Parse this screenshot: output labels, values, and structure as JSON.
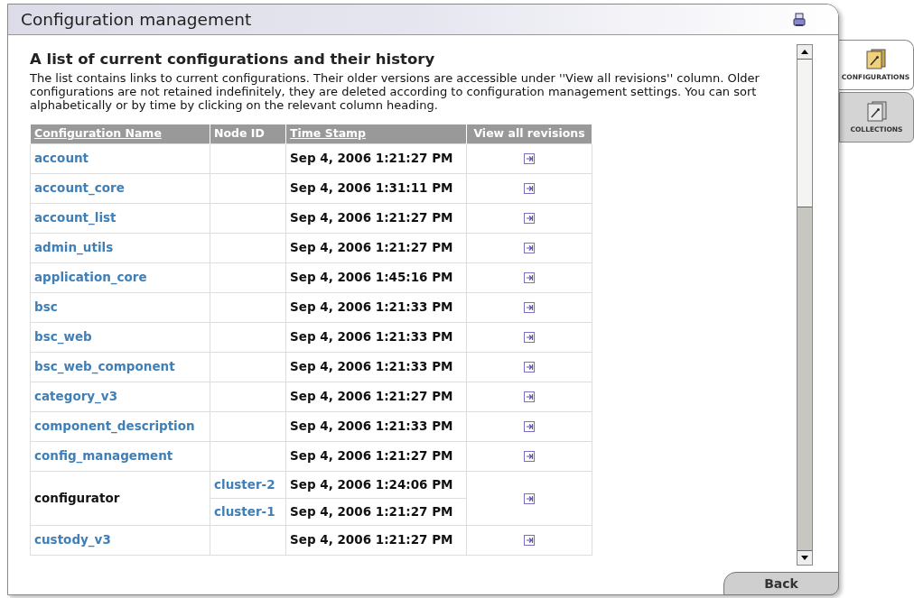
{
  "window": {
    "title": "Configuration management"
  },
  "heading": "A list of current configurations and their history",
  "description": "The list contains links to current configurations. Their older versions are accessible under ''View all revisions'' column. Older configurations are not retained indefinitely, they are deleted according to configuration management settings. You can sort alphabetically or by time by clicking on the relevant column heading.",
  "table": {
    "columns": [
      {
        "label": "Configuration Name",
        "sortable": true
      },
      {
        "label": "Node ID",
        "sortable": false
      },
      {
        "label": "Time Stamp",
        "sortable": true
      },
      {
        "label": "View all revisions",
        "sortable": false
      }
    ],
    "rows": [
      {
        "name": "account",
        "kind": "link",
        "entries": [
          {
            "time": "Sep 4, 2006 1:21:27 PM"
          }
        ]
      },
      {
        "name": "account_core",
        "kind": "link",
        "entries": [
          {
            "time": "Sep 4, 2006 1:31:11 PM"
          }
        ]
      },
      {
        "name": "account_list",
        "kind": "link",
        "entries": [
          {
            "time": "Sep 4, 2006 1:21:27 PM"
          }
        ]
      },
      {
        "name": "admin_utils",
        "kind": "link",
        "entries": [
          {
            "time": "Sep 4, 2006 1:21:27 PM"
          }
        ]
      },
      {
        "name": "application_core",
        "kind": "link",
        "entries": [
          {
            "time": "Sep 4, 2006 1:45:16 PM"
          }
        ]
      },
      {
        "name": "bsc",
        "kind": "link",
        "entries": [
          {
            "time": "Sep 4, 2006 1:21:33 PM"
          }
        ]
      },
      {
        "name": "bsc_web",
        "kind": "link",
        "entries": [
          {
            "time": "Sep 4, 2006 1:21:33 PM"
          }
        ]
      },
      {
        "name": "bsc_web_component",
        "kind": "link",
        "entries": [
          {
            "time": "Sep 4, 2006 1:21:33 PM"
          }
        ]
      },
      {
        "name": "category_v3",
        "kind": "link",
        "entries": [
          {
            "time": "Sep 4, 2006 1:21:27 PM"
          }
        ]
      },
      {
        "name": "component_description",
        "kind": "link",
        "entries": [
          {
            "time": "Sep 4, 2006 1:21:33 PM"
          }
        ]
      },
      {
        "name": "config_management",
        "kind": "link",
        "entries": [
          {
            "time": "Sep 4, 2006 1:21:27 PM"
          }
        ]
      },
      {
        "name": "configurator",
        "kind": "plain",
        "entries": [
          {
            "node": "cluster-2",
            "time": "Sep 4, 2006 1:24:06 PM"
          },
          {
            "node": "cluster-1",
            "time": "Sep 4, 2006 1:21:27 PM"
          }
        ]
      },
      {
        "name": "custody_v3",
        "kind": "link",
        "entries": [
          {
            "time": "Sep 4, 2006 1:21:27 PM"
          }
        ]
      }
    ]
  },
  "tabs": [
    {
      "label": "CONFIGURATIONS",
      "selected": true
    },
    {
      "label": "COLLECTIONS",
      "selected": false
    }
  ],
  "back_button": "Back"
}
